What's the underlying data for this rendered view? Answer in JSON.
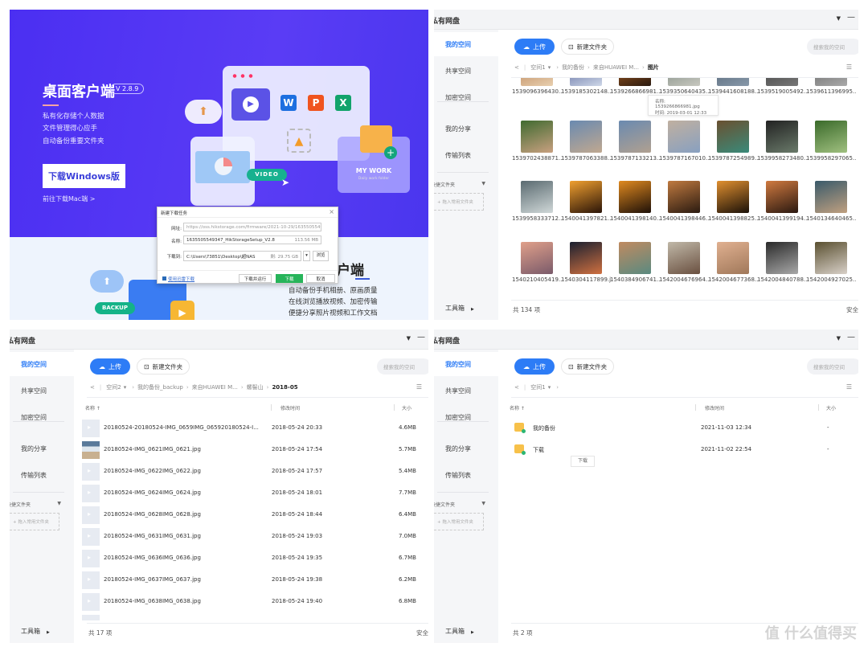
{
  "promo": {
    "title": "桌面客户端",
    "version": "V 2.8.9",
    "features": [
      "私有化存储个人数据",
      "文件管理得心应手",
      "自动备份重要文件夹"
    ],
    "download_windows": "下载Windows版",
    "download_mac": "前往下载Mac端  >",
    "illustration": {
      "video_tag": "VIDEO",
      "folder_title": "MY WORK",
      "folder_sub": "Daily work folder",
      "backup_tag": "BACKUP",
      "apps": [
        "W",
        "P",
        "X"
      ]
    },
    "lower_title": "客户端",
    "lower_features": [
      "自动备份手机相册、原画质量",
      "在线浏览播放视频、加密传输",
      "便捷分享照片视频和工作文档"
    ]
  },
  "download_dialog": {
    "title": "新建下载任务",
    "url_label": "网址:",
    "url": "https://oss.hikstorage.com/firmware/2021-10-29/1635505549347_H",
    "name_label": "名称:",
    "name": "1635505549347_HikStorageSetup_V2.8",
    "size": "113.56 MB",
    "dest_label": "下载到:",
    "dest": "C:\\Users\\73851\\Desktop\\超NAS",
    "free": "剩: 29.75 GB",
    "browse": "浏览",
    "thunder": "使用迅雷下载",
    "download_run": "下载并运行",
    "download": "下载",
    "cancel": "取消"
  },
  "app": {
    "title": "私有网盘",
    "sidebar": [
      "我的空间",
      "共享空间",
      "加密空间",
      "我的分享",
      "传输列表"
    ],
    "quick_folders": "快捷文件夹",
    "drag_hint": "+ 拖入常用文件夹",
    "toolbox": "工具箱",
    "upload": "上传",
    "new_folder": "新建文件夹",
    "search_placeholder": "搜索我的空间",
    "col_name": "名称 ↑",
    "col_modified": "修改时间",
    "col_size": "大小",
    "accent": "#2d7cf6"
  },
  "photos": {
    "breadcrumb": [
      "空间1",
      "我的备份",
      "来自HUAWEI M...",
      "图片"
    ],
    "count": "共 134 项",
    "footer_right": "安全",
    "tooltip": {
      "name": "名称: 1539266866981.jpg",
      "time": "时间: 2019-03-01 12:33"
    },
    "items": [
      "1539096396430...g",
      "1539185302148...g",
      "1539266866981...g",
      "1539350640435...g",
      "1539441608188...g",
      "1539519005492...g",
      "1539611396995...g",
      "1539702438871...g",
      "1539787063388...g",
      "1539787133213...g",
      "1539787167010...g",
      "1539787254989...g",
      "1539958273480...g",
      "1539958297065...g",
      "1539958333712...g",
      "1540041397821...g",
      "1540041398140...g",
      "1540041398446...g",
      "1540041398825...g",
      "1540041399194...g",
      "1540134640465...g",
      "1540210405419...g",
      "1540304117899.jpg",
      "1540384906741...g",
      "1542004676964...g",
      "1542004677368...g",
      "1542004840788...g",
      "1542004927025...g"
    ]
  },
  "list": {
    "breadcrumb": [
      "空间2",
      "我的备份_backup",
      "来自HUAWEI M...",
      "螺髻山",
      "2018-05"
    ],
    "count": "共 17 项",
    "footer_right": "安全",
    "rows": [
      {
        "name": "20180524-20180524-IMG_0659IMG_065920180524-I...",
        "modified": "2018-05-24 20:33",
        "size": "4.6MB"
      },
      {
        "name": "20180524-IMG_0621IMG_0621.jpg",
        "modified": "2018-05-24 17:54",
        "size": "5.7MB"
      },
      {
        "name": "20180524-IMG_0622IMG_0622.jpg",
        "modified": "2018-05-24 17:57",
        "size": "5.4MB"
      },
      {
        "name": "20180524-IMG_0624IMG_0624.jpg",
        "modified": "2018-05-24 18:01",
        "size": "7.7MB"
      },
      {
        "name": "20180524-IMG_0628IMG_0628.jpg",
        "modified": "2018-05-24 18:44",
        "size": "6.4MB"
      },
      {
        "name": "20180524-IMG_0631IMG_0631.jpg",
        "modified": "2018-05-24 19:03",
        "size": "7.0MB"
      },
      {
        "name": "20180524-IMG_0636IMG_0636.jpg",
        "modified": "2018-05-24 19:35",
        "size": "6.7MB"
      },
      {
        "name": "20180524-IMG_0637IMG_0637.jpg",
        "modified": "2018-05-24 19:38",
        "size": "6.2MB"
      },
      {
        "name": "20180524-IMG_0638IMG_0638.jpg",
        "modified": "2018-05-24 19:40",
        "size": "6.8MB"
      }
    ]
  },
  "root": {
    "breadcrumb": [
      "空间1"
    ],
    "count": "共 2 项",
    "rows": [
      {
        "name": "我的备份",
        "modified": "2021-11-03 12:34",
        "size": "-"
      },
      {
        "name": "下载",
        "modified": "2021-11-02 22:54",
        "size": "-"
      }
    ],
    "tooltip": "下载",
    "watermark": "值 什么值得买"
  }
}
